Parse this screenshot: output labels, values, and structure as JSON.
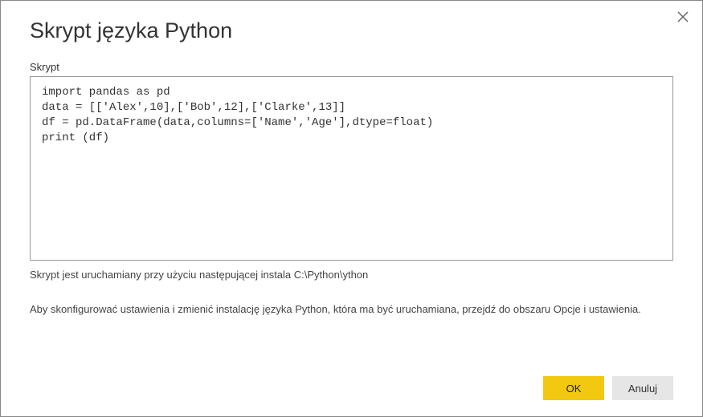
{
  "dialog": {
    "title": "Skrypt języka Python",
    "close_label": "Close"
  },
  "field": {
    "label": "Skrypt",
    "code": "import pandas as pd\ndata = [['Alex',10],['Bob',12],['Clarke',13]]\ndf = pd.DataFrame(data,columns=['Name','Age'],dtype=float)\nprint (df)"
  },
  "info": {
    "runtime": "Skrypt jest uruchamiany przy użyciu następującej instala C:\\Python\\ython",
    "config": "Aby skonfigurować ustawienia i zmienić instalację języka Python, która ma być uruchamiana, przejdź do obszaru Opcje i ustawienia."
  },
  "buttons": {
    "ok": "OK",
    "cancel": "Anuluj"
  }
}
